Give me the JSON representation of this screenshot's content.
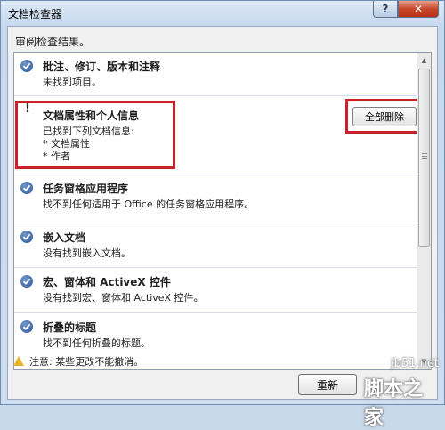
{
  "window": {
    "title": "文档检查器",
    "help_label": "?",
    "close_label": "✕"
  },
  "subtitle": "审阅检查结果。",
  "results": [
    {
      "status": "ok",
      "title": "批注、修订、版本和注释",
      "lines": [
        "未找到项目。"
      ]
    },
    {
      "status": "warning",
      "title": "文档属性和个人信息",
      "lines": [
        "已找到下列文档信息:",
        "* 文档属性",
        "* 作者"
      ],
      "action_label": "全部删除"
    },
    {
      "status": "ok",
      "title": "任务窗格应用程序",
      "lines": [
        "找不到任何适用于 Office 的任务窗格应用程序。"
      ]
    },
    {
      "status": "ok",
      "title": "嵌入文档",
      "lines": [
        "没有找到嵌入文档。"
      ]
    },
    {
      "status": "ok",
      "title": "宏、窗体和 ActiveX 控件",
      "lines": [
        "没有找到宏、窗体和 ActiveX 控件。"
      ]
    },
    {
      "status": "ok",
      "title": "折叠的标题",
      "lines": [
        "找不到任何折叠的标题。"
      ]
    }
  ],
  "footer": {
    "warning_text": "注意: 某些更改不能撤消。",
    "reinspect_label": "重新"
  },
  "watermark": {
    "site": "jb51.net",
    "name": "脚本之家"
  },
  "colors": {
    "highlight": "#c9202a",
    "status_ok": "#2f5d9e",
    "warning": "#e8b32a"
  }
}
